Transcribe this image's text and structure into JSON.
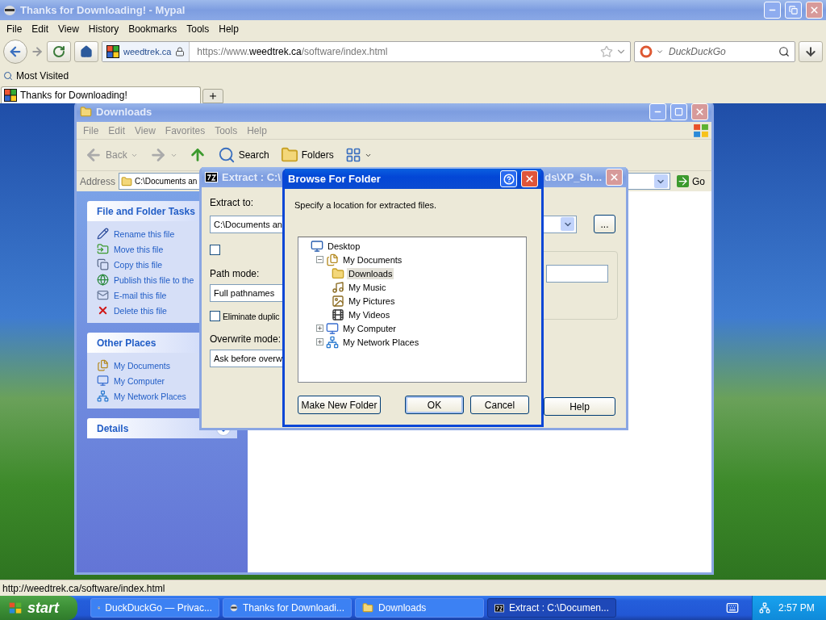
{
  "browser": {
    "title": "Thanks for Downloading! - Mypal",
    "menu": [
      "File",
      "Edit",
      "View",
      "History",
      "Bookmarks",
      "Tools",
      "Help"
    ],
    "identity": "weedtrek.ca",
    "url": {
      "prefix": "https://www.",
      "domain": "weedtrek.ca",
      "path": "/software/index.html"
    },
    "search": {
      "placeholder": "DuckDuckGo"
    },
    "bookmarks": [
      "Most Visited"
    ],
    "tabs": [
      {
        "label": "Thanks for Downloading!",
        "selected": true
      }
    ],
    "status": "http://weedtrek.ca/software/index.html"
  },
  "explorer": {
    "title": "Downloads",
    "menu": [
      "File",
      "Edit",
      "View",
      "Favorites",
      "Tools",
      "Help"
    ],
    "toolbar": [
      {
        "kind": "back",
        "label": "Back"
      },
      {
        "kind": "forward"
      },
      {
        "kind": "up"
      },
      {
        "kind": "search",
        "label": "Search"
      },
      {
        "kind": "folders",
        "label": "Folders"
      },
      {
        "kind": "views"
      }
    ],
    "address": {
      "label": "Address",
      "value": "C:\\Documents an"
    },
    "go": "Go",
    "panels": [
      {
        "title": "File and Folder Tasks",
        "expanded": true,
        "items": [
          {
            "kind": "rename",
            "label": "Rename this file"
          },
          {
            "kind": "move",
            "label": "Move this file"
          },
          {
            "kind": "copy",
            "label": "Copy this file"
          },
          {
            "kind": "publish",
            "label": "Publish this file to the"
          },
          {
            "kind": "email",
            "label": "E-mail this file"
          },
          {
            "kind": "delete",
            "label": "Delete this file"
          }
        ]
      },
      {
        "title": "Other Places",
        "expanded": true,
        "items": [
          {
            "kind": "documents",
            "label": "My Documents"
          },
          {
            "kind": "computer",
            "label": "My Computer"
          },
          {
            "kind": "network",
            "label": "My Network Places"
          }
        ]
      },
      {
        "title": "Details",
        "expanded": false
      }
    ]
  },
  "extract": {
    "title_start": "Extract : C:\\",
    "title_end": "ds\\XP_Sh...",
    "extract_to": {
      "label": "Extract to:",
      "value": "C:\\Documents an"
    },
    "browse_button": "...",
    "checkbox": {
      "checked": false
    },
    "path_mode": {
      "label": "Path mode:",
      "value": "Full pathnames"
    },
    "eliminate": {
      "label": "Eliminate duplic",
      "checked": false
    },
    "overwrite_mode": {
      "label": "Overwrite mode:",
      "value": "Ask before overw"
    },
    "help": "Help"
  },
  "browse": {
    "title": "Browse For Folder",
    "prompt": "Specify a location for extracted files.",
    "tree": [
      {
        "kind": "desktop",
        "label": "Desktop",
        "selected": false,
        "children": [
          {
            "kind": "documents",
            "label": "My Documents",
            "selected": false,
            "expanded": true,
            "children": [
              {
                "kind": "folder",
                "label": "Downloads",
                "selected": true
              },
              {
                "kind": "music",
                "label": "My Music",
                "selected": false
              },
              {
                "kind": "pictures",
                "label": "My Pictures",
                "selected": false
              },
              {
                "kind": "videos",
                "label": "My Videos",
                "selected": false
              }
            ]
          },
          {
            "kind": "computer",
            "label": "My Computer",
            "selected": false,
            "expanded": false
          },
          {
            "kind": "network",
            "label": "My Network Places",
            "selected": false,
            "expanded": false
          }
        ]
      }
    ],
    "buttons": [
      {
        "kind": "new",
        "label": "Make New Folder"
      },
      {
        "kind": "ok",
        "label": "OK"
      },
      {
        "kind": "cancel",
        "label": "Cancel"
      }
    ]
  },
  "taskbar": {
    "start": "start",
    "tasks": [
      {
        "kind": "browser",
        "label": "DuckDuckGo — Privac...",
        "selected": false
      },
      {
        "kind": "browser",
        "label": "Thanks for Downloadi...",
        "selected": false
      },
      {
        "kind": "folder",
        "label": "Downloads",
        "selected": false
      },
      {
        "kind": "archive",
        "label": "Extract : C:\\Documen...",
        "selected": true
      }
    ],
    "clock": "2:57 PM"
  }
}
